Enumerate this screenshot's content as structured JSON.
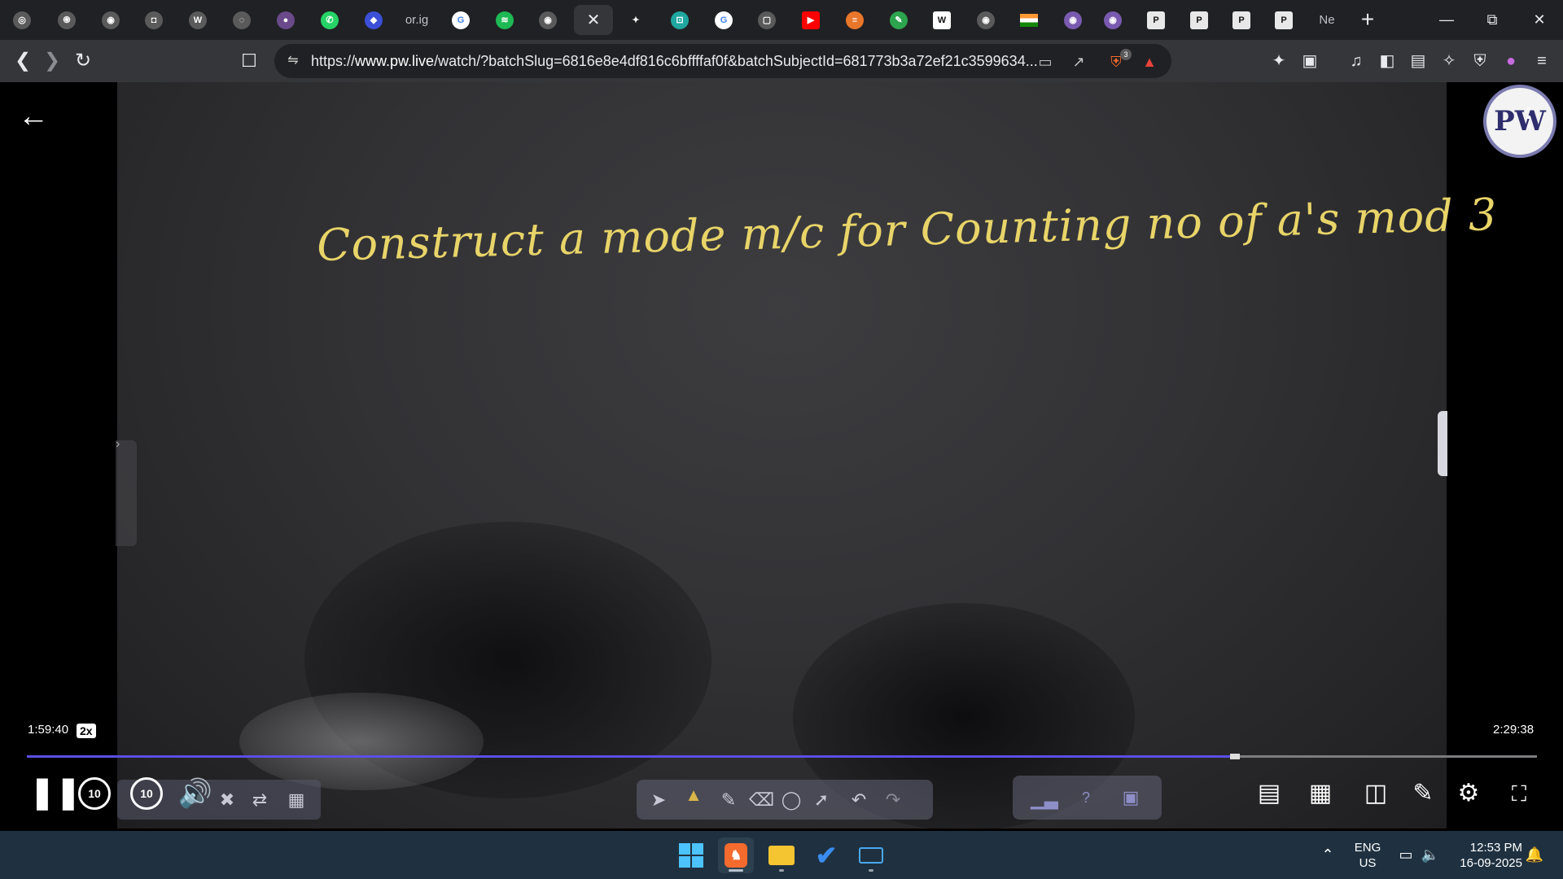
{
  "browser": {
    "tabs": [
      {
        "icon": "chatgpt-icon",
        "color": "#5a5a5a",
        "glyph": "◎"
      },
      {
        "icon": "swirl-icon",
        "color": "#5a5a5a",
        "glyph": "֍"
      },
      {
        "icon": "globe-icon",
        "color": "#5a5a5a",
        "glyph": "◉"
      },
      {
        "icon": "vscode-icon",
        "color": "#5a5a5a",
        "glyph": "◘"
      },
      {
        "icon": "w3schools-icon",
        "color": "#5a5a5a",
        "glyph": "W"
      },
      {
        "icon": "site-icon",
        "color": "#5a5a5a",
        "glyph": "◌"
      },
      {
        "icon": "purple-orb-icon",
        "color": "#6a4a8a",
        "glyph": "●"
      },
      {
        "icon": "whatsapp-icon",
        "color": "#25d366",
        "glyph": "✆"
      },
      {
        "icon": "blue-shield-icon",
        "color": "#3b4fd8",
        "glyph": "◆"
      },
      {
        "icon": "orgin-icon",
        "label": "or.ig",
        "color": "#202124",
        "glyph": ""
      },
      {
        "icon": "google-icon",
        "color": "#ffffff",
        "glyph": "G"
      },
      {
        "icon": "spotify-icon",
        "color": "#1db954",
        "glyph": "≋"
      },
      {
        "icon": "globe-icon",
        "color": "#5a5a5a",
        "glyph": "◉"
      },
      {
        "icon": "close-icon",
        "active": true,
        "glyph": "✕"
      },
      {
        "icon": "gemini-icon",
        "color": "#202124",
        "glyph": "✦"
      },
      {
        "icon": "perplexity-icon",
        "color": "#1fa7a0",
        "glyph": "⊡"
      },
      {
        "icon": "google-icon",
        "color": "#ffffff",
        "glyph": "G"
      },
      {
        "icon": "window-icon",
        "color": "#5a5a5a",
        "glyph": "▢"
      },
      {
        "icon": "youtube-icon",
        "color": "#ff0000",
        "glyph": "▶"
      },
      {
        "icon": "burger-icon",
        "color": "#e8762b",
        "glyph": "≡"
      },
      {
        "icon": "leetcode-icon",
        "color": "#2da44e",
        "glyph": "✎"
      },
      {
        "icon": "wikipedia-icon",
        "color": "#ffffff",
        "glyph": "W"
      },
      {
        "icon": "globe-icon",
        "color": "#5a5a5a",
        "glyph": "◉"
      },
      {
        "icon": "india-flag-icon",
        "color": "#ff9933",
        "glyph": ""
      },
      {
        "icon": "purple-badge-icon",
        "color": "#7a5ab0",
        "glyph": "◉"
      },
      {
        "icon": "purple-badge-icon",
        "color": "#7a5ab0",
        "glyph": "◉"
      },
      {
        "icon": "pw-icon",
        "color": "#e8e8e8",
        "glyph": "P"
      },
      {
        "icon": "pw-icon",
        "color": "#e8e8e8",
        "glyph": "P"
      },
      {
        "icon": "pw-icon",
        "color": "#e8e8e8",
        "glyph": "P"
      },
      {
        "icon": "pw-icon",
        "color": "#e8e8e8",
        "glyph": "P"
      },
      {
        "icon": "new-tab-page-icon",
        "label": "Ne",
        "glyph": ""
      }
    ],
    "url_prefix": "https://",
    "url_host": "www.pw.live",
    "url_rest": "/watch/?batchSlug=6816e8e4df816c6bffffaf0f&batchSubjectId=681773b3a72ef21c3599634...",
    "brave_shield_count": "3"
  },
  "video": {
    "board_text": "Construct a mode m/c for Counting no of a's mod 3",
    "logo": "PW",
    "time_current": "1:59:40",
    "speed": "2x",
    "time_total": "2:29:38",
    "progress": 0.8,
    "skip_back": "10",
    "skip_forward": "10"
  },
  "taskbar": {
    "lang_top": "ENG",
    "lang_bottom": "US",
    "time": "12:53 PM",
    "date": "16-09-2025"
  },
  "colors": {
    "progress": "#5a4fe6",
    "chalk": "#e8d468"
  }
}
